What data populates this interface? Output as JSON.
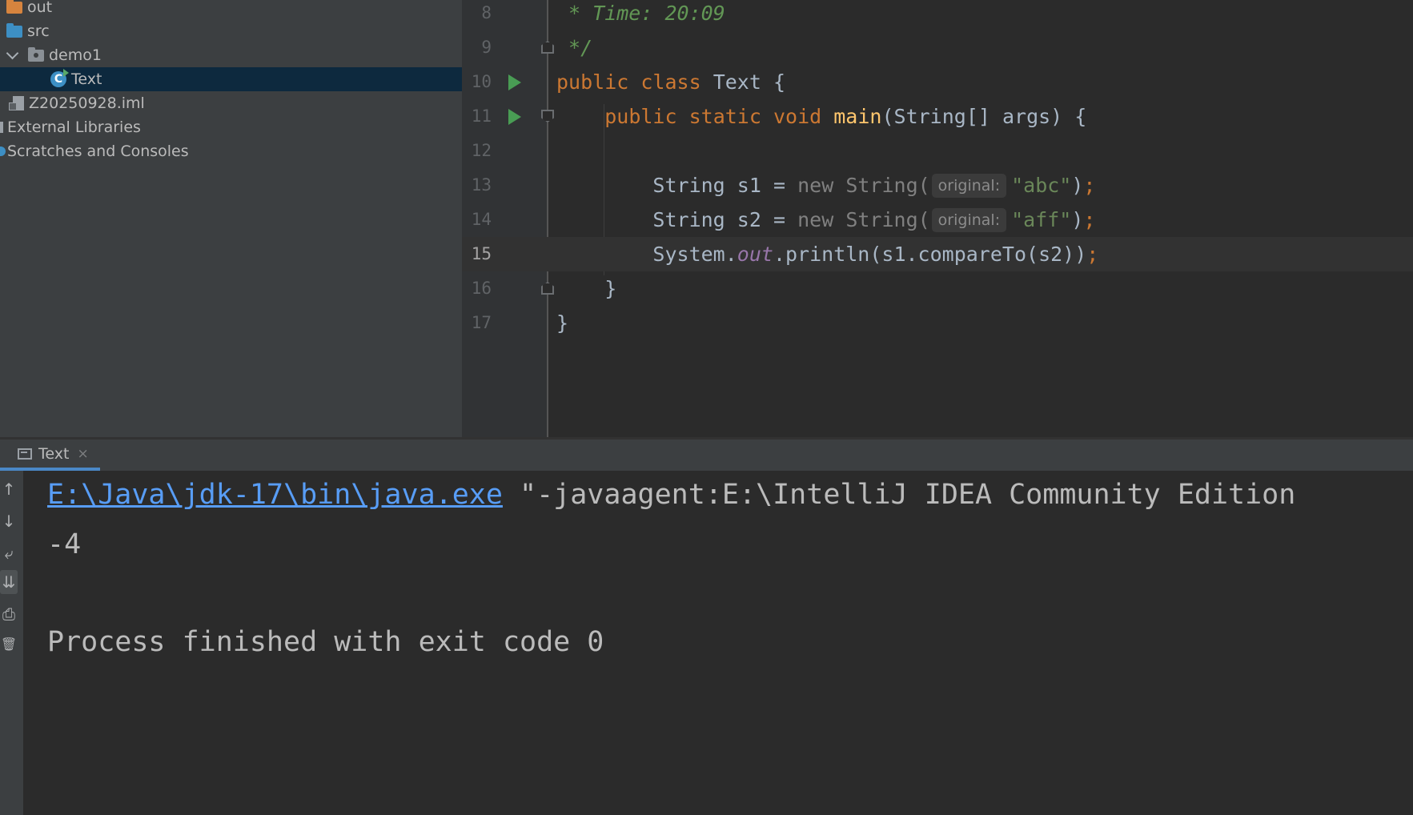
{
  "project_tree": {
    "items": [
      {
        "label": "out",
        "icon": "folder-orange-icon"
      },
      {
        "label": "src",
        "icon": "folder-blue-icon"
      },
      {
        "label": "demo1",
        "icon": "package-folder-icon"
      },
      {
        "label": "Text",
        "icon": "java-class-icon"
      },
      {
        "label": "Z20250928.iml",
        "icon": "iml-file-icon"
      },
      {
        "label": "External Libraries",
        "icon": "libraries-icon"
      },
      {
        "label": "Scratches and Consoles",
        "icon": "scratches-icon"
      }
    ],
    "selected": "Text"
  },
  "editor": {
    "line_numbers": [
      "8",
      "9",
      "10",
      "11",
      "12",
      "13",
      "14",
      "15",
      "16",
      "17"
    ],
    "current_line": "15",
    "comment_time": " * Time: 20:09",
    "comment_end": " */",
    "kw_public": "public",
    "kw_class": "class",
    "kw_static": "static",
    "kw_void": "void",
    "kw_new": "new",
    "class_name": "Text",
    "method_name": "main",
    "params": "(String[] args) {",
    "brace_open": "{",
    "brace_close": "}",
    "type_string": "String",
    "var_s1": "s1",
    "var_s2": "s2",
    "ctor_open": "String(",
    "param_hint": "original:",
    "literal_1": "\"abc\"",
    "literal_2": "\"aff\"",
    "close_paren": ")",
    "semicolon": ";",
    "equals": "=",
    "system": "System.",
    "out_field": "out",
    "println_call": ".println(s1.compareTo(s2))"
  },
  "run_panel": {
    "tab_label": "Text",
    "close_symbol": "×",
    "toolbar": {
      "up": "↑",
      "down": "↓",
      "wrap": "⤶",
      "scroll_end": "⇊",
      "print": "⎙",
      "clear": "🗑"
    },
    "console": {
      "java_path": "E:\\Java\\jdk-17\\bin\\java.exe",
      "command_rest": " \"-javaagent:E:\\IntelliJ IDEA Community Edition",
      "output": "-4",
      "exit_message": "Process finished with exit code 0"
    }
  },
  "colors": {
    "keyword": "#cc7832",
    "string": "#6a8759",
    "comment": "#629755",
    "link": "#589df6",
    "run_icon": "#499c54"
  }
}
